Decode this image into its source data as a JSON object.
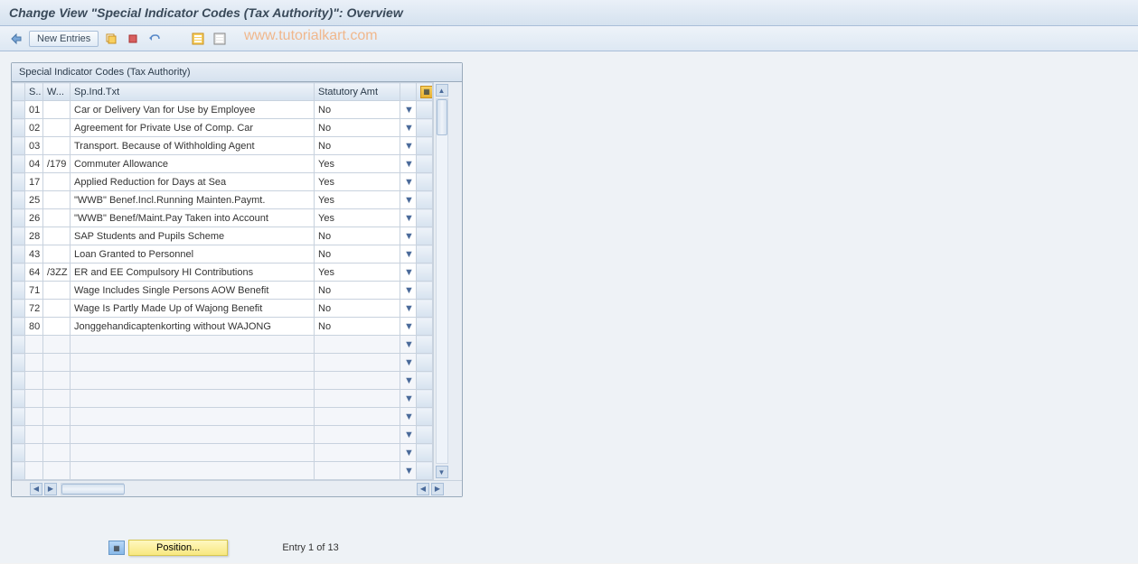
{
  "title": "Change View \"Special Indicator Codes (Tax Authority)\": Overview",
  "toolbar": {
    "new_entries_label": "New Entries",
    "watermark": "www.tutorialkart.com"
  },
  "panel": {
    "header": "Special Indicator Codes (Tax Authority)",
    "columns": {
      "s": "S..",
      "w": "W...",
      "txt": "Sp.Ind.Txt",
      "stat": "Statutory Amt"
    }
  },
  "rows": [
    {
      "s": "01",
      "w": "",
      "txt": "Car or Delivery Van for Use by Employee",
      "stat": "No"
    },
    {
      "s": "02",
      "w": "",
      "txt": "Agreement for Private Use of Comp. Car",
      "stat": "No"
    },
    {
      "s": "03",
      "w": "",
      "txt": "Transport. Because of Withholding Agent",
      "stat": "No"
    },
    {
      "s": "04",
      "w": "/179",
      "txt": "Commuter Allowance",
      "stat": "Yes"
    },
    {
      "s": "17",
      "w": "",
      "txt": "Applied Reduction for Days at Sea",
      "stat": "Yes"
    },
    {
      "s": "25",
      "w": "",
      "txt": "\"WWB\" Benef.Incl.Running Mainten.Paymt.",
      "stat": "Yes"
    },
    {
      "s": "26",
      "w": "",
      "txt": "\"WWB\" Benef/Maint.Pay Taken into Account",
      "stat": "Yes"
    },
    {
      "s": "28",
      "w": "",
      "txt": "SAP Students and Pupils Scheme",
      "stat": "No"
    },
    {
      "s": "43",
      "w": "",
      "txt": "Loan Granted to Personnel",
      "stat": "No"
    },
    {
      "s": "64",
      "w": "/3ZZ",
      "txt": "ER and EE Compulsory HI Contributions",
      "stat": "Yes"
    },
    {
      "s": "71",
      "w": "",
      "txt": "Wage Includes Single Persons AOW Benefit",
      "stat": "No"
    },
    {
      "s": "72",
      "w": "",
      "txt": "Wage Is Partly Made Up of Wajong Benefit",
      "stat": "No"
    },
    {
      "s": "80",
      "w": "",
      "txt": "Jonggehandicaptenkorting without WAJONG",
      "stat": "No"
    }
  ],
  "empty_rows": 8,
  "footer": {
    "position_label": "Position...",
    "entry_info": "Entry 1 of 13"
  }
}
